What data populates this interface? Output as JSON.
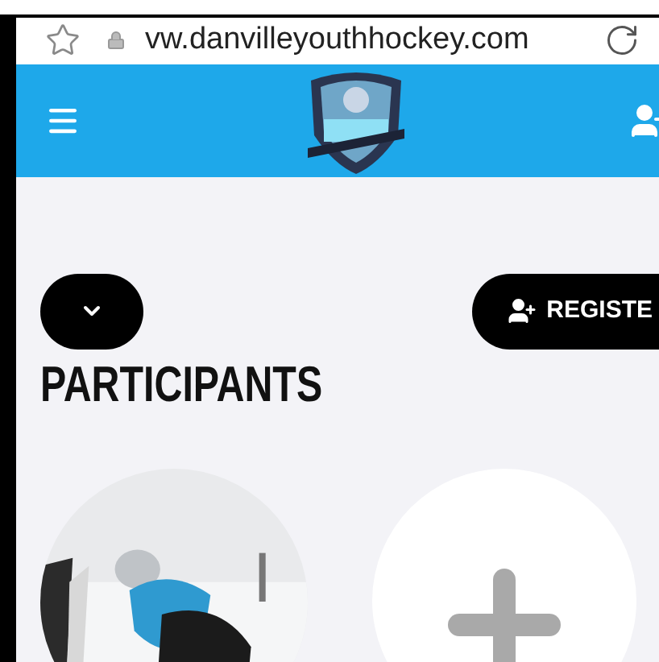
{
  "browser": {
    "url": "vw.danvilleyouthhockey.com"
  },
  "header": {
    "logo": {
      "kind": "logo"
    }
  },
  "toolbar": {
    "register_button": "REGISTE"
  },
  "section": {
    "title": "PARTICIPANTS"
  },
  "participants": [
    {
      "kind": "picture"
    },
    {
      "kind": "add"
    }
  ]
}
